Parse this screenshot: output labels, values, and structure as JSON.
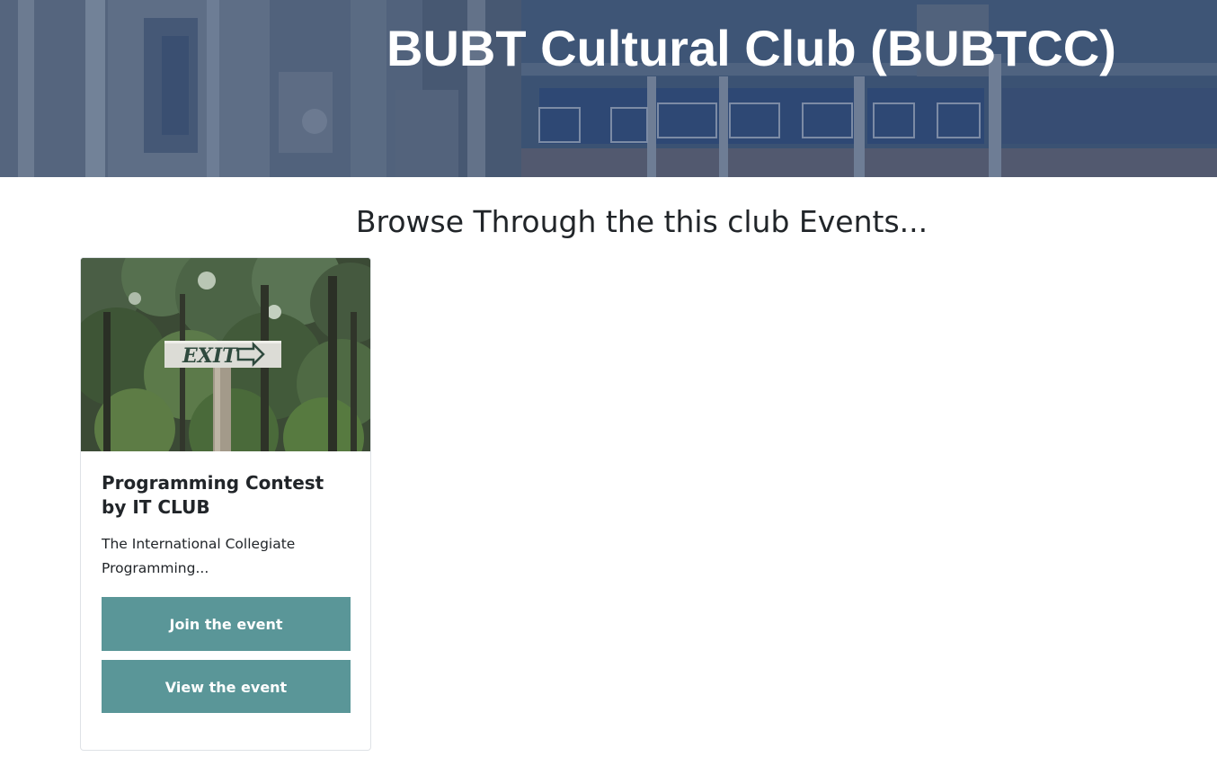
{
  "banner": {
    "title": "BUBT Cultural Club (BUBTCC)",
    "image_icon": "campus-building-photo"
  },
  "events_section": {
    "heading": "Browse Through the this club Events..."
  },
  "events": [
    {
      "image_icon": "exit-sign-forest-photo",
      "title": "Programming Contest by IT CLUB",
      "description": "The International Collegiate Programming...",
      "join_label": "Join the event",
      "view_label": "View the event"
    }
  ],
  "colors": {
    "button_bg": "#5a9698",
    "button_text": "#ffffff",
    "banner_overlay": "#3e5678"
  }
}
